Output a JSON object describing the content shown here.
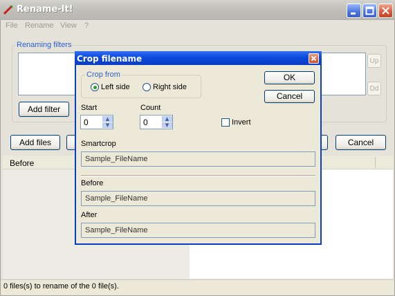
{
  "window": {
    "title": "Rename-It!",
    "minimize_icon": "minimize-icon",
    "maximize_icon": "maximize-icon",
    "close_icon": "close-icon"
  },
  "menu": [
    "File",
    "Rename",
    "View",
    "?"
  ],
  "filters": {
    "legend": "Renaming filters",
    "add_filter": "Add filter",
    "up": "Up",
    "down": "Dd"
  },
  "toolbar": {
    "add_files": "Add files",
    "cancel": "Cancel"
  },
  "list": {
    "column_before": "Before"
  },
  "status": "0 files(s) to rename of the 0 file(s).",
  "dialog": {
    "title": "Crop filename",
    "crop_from_legend": "Crop from",
    "left_side": "Left side",
    "right_side": "Right side",
    "crop_from_selected": "Left side",
    "ok": "OK",
    "cancel": "Cancel",
    "start_label": "Start",
    "start_value": "0",
    "count_label": "Count",
    "count_value": "0",
    "invert_label": "Invert",
    "invert_checked": false,
    "smartcrop_label": "Smartcrop",
    "smartcrop_value": "Sample_FileName",
    "before_label": "Before",
    "before_value": "Sample_FileName",
    "after_label": "After",
    "after_value": "Sample_FileName"
  },
  "colors": {
    "dialog_title": "#0a47d8",
    "legend_blue": "#2a5fd5"
  }
}
